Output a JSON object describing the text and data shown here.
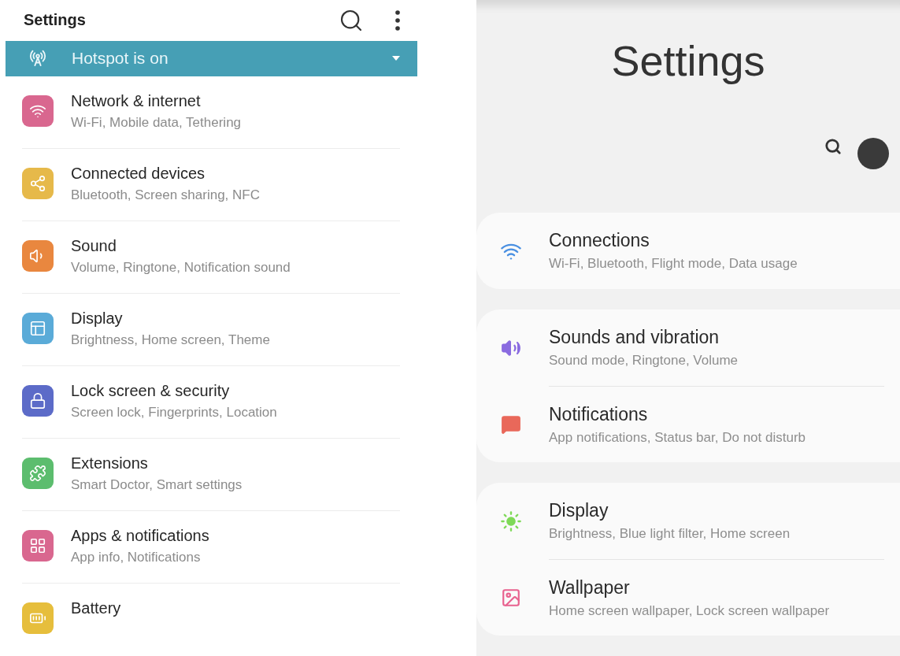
{
  "left_screen": {
    "title": "Settings",
    "banner": {
      "label": "Hotspot is on"
    },
    "items": [
      {
        "kind": "wifi",
        "color": "#d9678f",
        "title": "Network & internet",
        "subtitle": "Wi-Fi, Mobile data, Tethering"
      },
      {
        "kind": "share",
        "color": "#e6b94a",
        "title": "Connected devices",
        "subtitle": "Bluetooth, Screen sharing, NFC"
      },
      {
        "kind": "speaker",
        "color": "#e9873f",
        "title": "Sound",
        "subtitle": "Volume, Ringtone, Notification sound"
      },
      {
        "kind": "display",
        "color": "#5aabd8",
        "title": "Display",
        "subtitle": "Brightness, Home screen, Theme"
      },
      {
        "kind": "lock",
        "color": "#5c6bc8",
        "title": "Lock screen & security",
        "subtitle": "Screen lock, Fingerprints, Location"
      },
      {
        "kind": "extension",
        "color": "#5cbd6e",
        "title": "Extensions",
        "subtitle": "Smart Doctor, Smart settings"
      },
      {
        "kind": "apps",
        "color": "#d9678f",
        "title": "Apps & notifications",
        "subtitle": "App info, Notifications"
      },
      {
        "kind": "battery",
        "color": "#e6be3c",
        "title": "Battery"
      }
    ]
  },
  "right_screen": {
    "title": "Settings",
    "groups": [
      [
        {
          "kind": "wifi",
          "color": "#4a90e2",
          "title": "Connections",
          "subtitle": "Wi-Fi, Bluetooth, Flight mode, Data usage"
        }
      ],
      [
        {
          "kind": "speaker",
          "color": "#8a6be0",
          "title": "Sounds and vibration",
          "subtitle": "Sound mode, Ringtone, Volume"
        },
        {
          "kind": "notification",
          "color": "#e9685a",
          "title": "Notifications",
          "subtitle": "App notifications, Status bar, Do not disturb"
        }
      ],
      [
        {
          "kind": "sun",
          "color": "#7ed957",
          "title": "Display",
          "subtitle": "Brightness, Blue light filter, Home screen"
        },
        {
          "kind": "wallpaper",
          "color": "#e8628f",
          "title": "Wallpaper",
          "subtitle": "Home screen wallpaper, Lock screen wallpaper"
        }
      ]
    ]
  }
}
